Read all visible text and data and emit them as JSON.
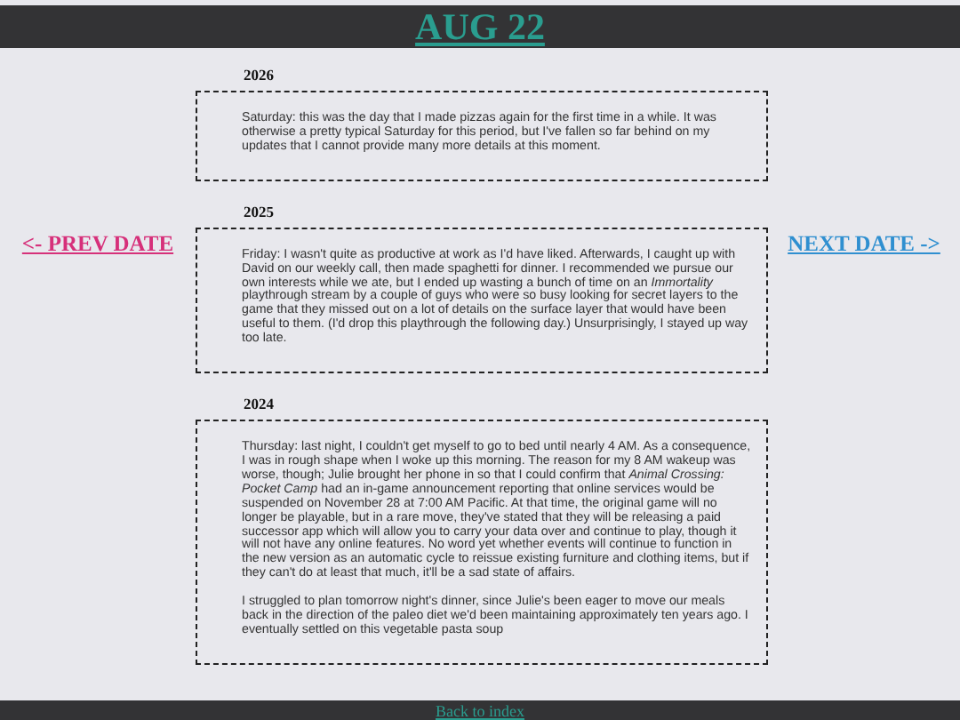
{
  "header": {
    "title": "AUG 22"
  },
  "nav": {
    "prev": "<- PREV DATE",
    "next": "NEXT DATE ->"
  },
  "entries": [
    {
      "year": "2026",
      "paragraphs": [
        "Saturday: this was the day that I made pizzas again for the first time in a while. It was otherwise a pretty typical Saturday for this period, but I've fallen so far behind on my updates that I cannot provide many more details at this moment."
      ]
    },
    {
      "year": "2025",
      "paragraphs": [
        "Friday: I wasn't quite as productive at work as I'd have liked. Afterwards, I caught up with David on our weekly call, then made spaghetti for dinner. I recommended we pursue our own interests while we ate, but I ended up wasting a bunch of time on an *Immortality* playthrough stream by a couple of guys who were so busy looking for secret layers to the game that they missed out on a lot of details on the surface layer that would have been useful to them. (I'd drop this playthrough the following day.) Unsurprisingly, I stayed up way too late."
      ]
    },
    {
      "year": "2024",
      "paragraphs": [
        "Thursday: last night, I couldn't get myself to go to bed until nearly 4 AM. As a consequence, I was in rough shape when I woke up this morning. The reason for my 8 AM wakeup was worse, though; Julie brought her phone in so that I could confirm that *Animal Crossing: Pocket Camp* had an in-game announcement reporting that online services would be suspended on November 28 at 7:00 AM Pacific. At that time, the original game will no longer be playable, but in a rare move, they've stated that they will be releasing a paid successor app which will allow you to carry your data over and continue to play, though it will not have any online features. No word yet whether events will continue to function in the new version as an automatic cycle to reissue existing furniture and clothing items, but if they can't do at least that much, it'll be a sad state of affairs.",
        "I struggled to plan tomorrow night's dinner, since Julie's been eager to move our meals back in the direction of the paleo diet we'd been maintaining approximately ten years ago. I eventually settled on this vegetable pasta soup"
      ]
    }
  ],
  "footer": {
    "link": "Back to index"
  }
}
